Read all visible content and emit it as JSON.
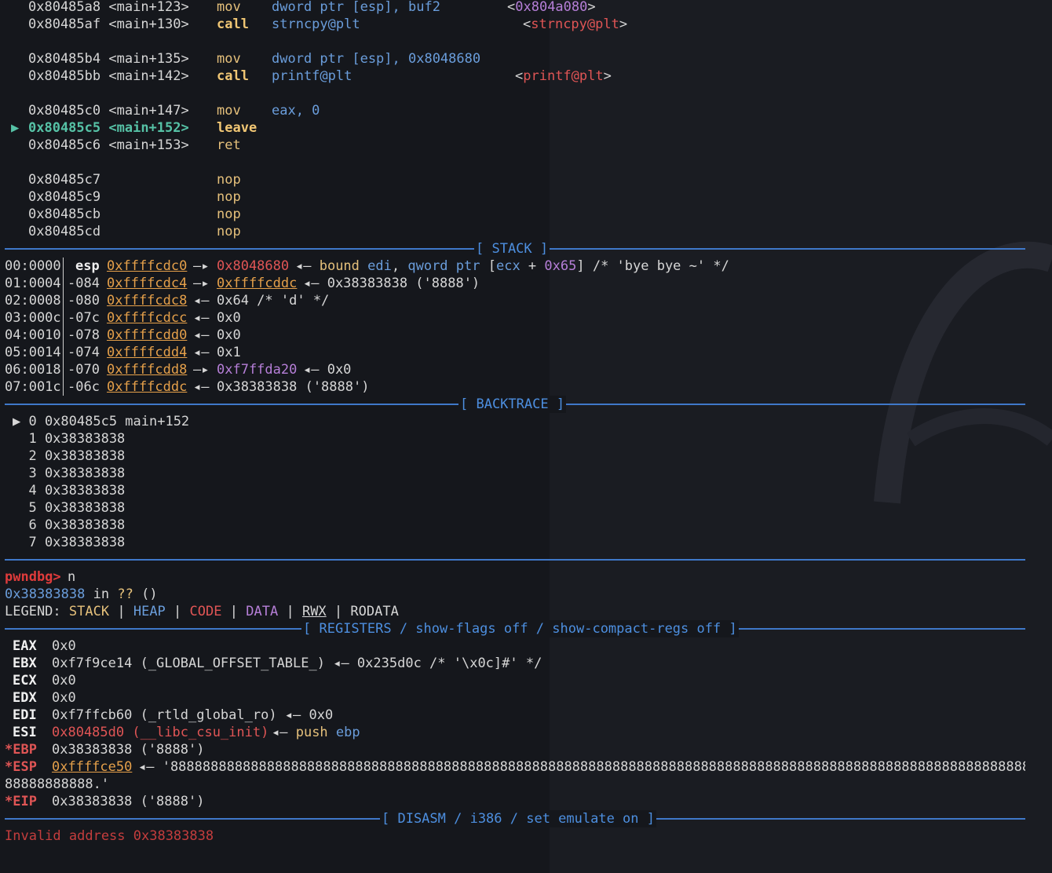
{
  "disasm_top": [
    {
      "addr": "0x80485a8",
      "sym": "<main+123>",
      "mn": "mov",
      "ops": [
        {
          "t": "dword ptr [esp], buf2",
          "c": "op"
        }
      ],
      "target": "<0x804a080>",
      "target_inner": "0x804a080"
    },
    {
      "addr": "0x80485af",
      "sym": "<main+130>",
      "mn": "call",
      "ops": [
        {
          "t": "strncpy@plt",
          "c": "op"
        }
      ],
      "target_inner": "strncpy@plt"
    },
    {
      "addr": "0x80485b4",
      "sym": "<main+135>",
      "mn": "mov",
      "ops": [
        {
          "t": "dword ptr [esp], 0x8048680",
          "c": "op"
        }
      ]
    },
    {
      "addr": "0x80485bb",
      "sym": "<main+142>",
      "mn": "call",
      "ops": [
        {
          "t": "printf@plt",
          "c": "op"
        }
      ],
      "target_inner": "printf@plt"
    },
    {
      "addr": "0x80485c0",
      "sym": "<main+147>",
      "mn": "mov",
      "ops": [
        {
          "t": "eax, 0",
          "c": "op"
        }
      ]
    },
    {
      "addr": "0x80485c5",
      "sym": "<main+152>",
      "mn": "leave",
      "current": true
    },
    {
      "addr": "0x80485c6",
      "sym": "<main+153>",
      "mn": "ret"
    },
    {
      "addr": "0x80485c7",
      "mn": "nop"
    },
    {
      "addr": "0x80485c9",
      "mn": "nop"
    },
    {
      "addr": "0x80485cb",
      "mn": "nop"
    },
    {
      "addr": "0x80485cd",
      "mn": "nop"
    }
  ],
  "current_marker": "▶",
  "section_stack": "[ STACK ]",
  "stack": [
    {
      "idx": "00:0000",
      "off": "esp",
      "addr": "0xffffcdc0",
      "arrow": "—▸",
      "val": "0x8048680",
      "rest": "◂— bound edi, qword ptr [ecx + 0x65] /* 'bye bye ~' */"
    },
    {
      "idx": "01:0004",
      "off": "-084",
      "addr": "0xffffcdc4",
      "arrow": "—▸",
      "val": "0xffffcddc",
      "rest": "◂— 0x38383838 ('8888')"
    },
    {
      "idx": "02:0008",
      "off": "-080",
      "addr": "0xffffcdc8",
      "arrow": "◂—",
      "val": "0x64 /* 'd' */",
      "rest": ""
    },
    {
      "idx": "03:000c",
      "off": "-07c",
      "addr": "0xffffcdcc",
      "arrow": "◂—",
      "val": "0x0",
      "rest": ""
    },
    {
      "idx": "04:0010",
      "off": "-078",
      "addr": "0xffffcdd0",
      "arrow": "◂—",
      "val": "0x0",
      "rest": ""
    },
    {
      "idx": "05:0014",
      "off": "-074",
      "addr": "0xffffcdd4",
      "arrow": "◂—",
      "val": "0x1",
      "rest": ""
    },
    {
      "idx": "06:0018",
      "off": "-070",
      "addr": "0xffffcdd8",
      "arrow": "—▸",
      "val": "0xf7ffda20",
      "rest": "◂— 0x0"
    },
    {
      "idx": "07:001c",
      "off": "-06c",
      "addr": "0xffffcddc",
      "arrow": "◂—",
      "val": "0x38383838 ('8888')",
      "rest": ""
    }
  ],
  "section_backtrace": "[ BACKTRACE ]",
  "backtrace": [
    "▶ 0 0x80485c5 main+152",
    "  1 0x38383838",
    "  2 0x38383838",
    "  3 0x38383838",
    "  4 0x38383838",
    "  5 0x38383838",
    "  6 0x38383838",
    "  7 0x38383838"
  ],
  "prompt": "pwndbg>",
  "command": "n",
  "pc_line": {
    "addr": "0x38383838",
    "in": "in",
    "qq": "??",
    "paren": "()"
  },
  "legend": {
    "label": "LEGEND:",
    "stack": "STACK",
    "heap": "HEAP",
    "code": "CODE",
    "data": "DATA",
    "rwx": "RWX",
    "rodata": "RODATA",
    "sep": "|"
  },
  "section_registers": "[ REGISTERS / show-flags off / show-compact-regs off ]",
  "registers": [
    {
      "name": "EAX",
      "val": "0x0"
    },
    {
      "name": "EBX",
      "val": "0xf7f9ce14 (_GLOBAL_OFFSET_TABLE_) ◂— 0x235d0c /* '\\x0c]#' */"
    },
    {
      "name": "ECX",
      "val": "0x0"
    },
    {
      "name": "EDX",
      "val": "0x0"
    },
    {
      "name": "EDI",
      "val": "0xf7ffcb60 (_rtld_global_ro) ◂— 0x0"
    },
    {
      "name": "ESI",
      "val": "0x80485d0 (__libc_csu_init)",
      "tail": "◂— push ebp"
    },
    {
      "name": "*EBP",
      "val": "0x38383838 ('8888')",
      "changed": true
    },
    {
      "name": "*ESP",
      "val": "0xffffce50",
      "tail": "◂— '88888888888888888888888888888888888888888888888888888888888888888888888888888888888888888888888888888888888888888888888888888888888888888888888888888888888888888888888888888888888888888888888888888888888888888888888888888",
      "wrap": "88888888888.'",
      "changed": true
    },
    {
      "name": "*EIP",
      "val": "0x38383838 ('8888')",
      "changed": true
    }
  ],
  "section_disasm": "[ DISASM / i386 / set emulate on ]",
  "error": "Invalid address 0x38383838",
  "colors": {
    "bg": "#15171c",
    "sep": "#3f78c9",
    "prompt": "#e03b3b",
    "error": "#c43d3d",
    "current": "#56c2a6"
  }
}
